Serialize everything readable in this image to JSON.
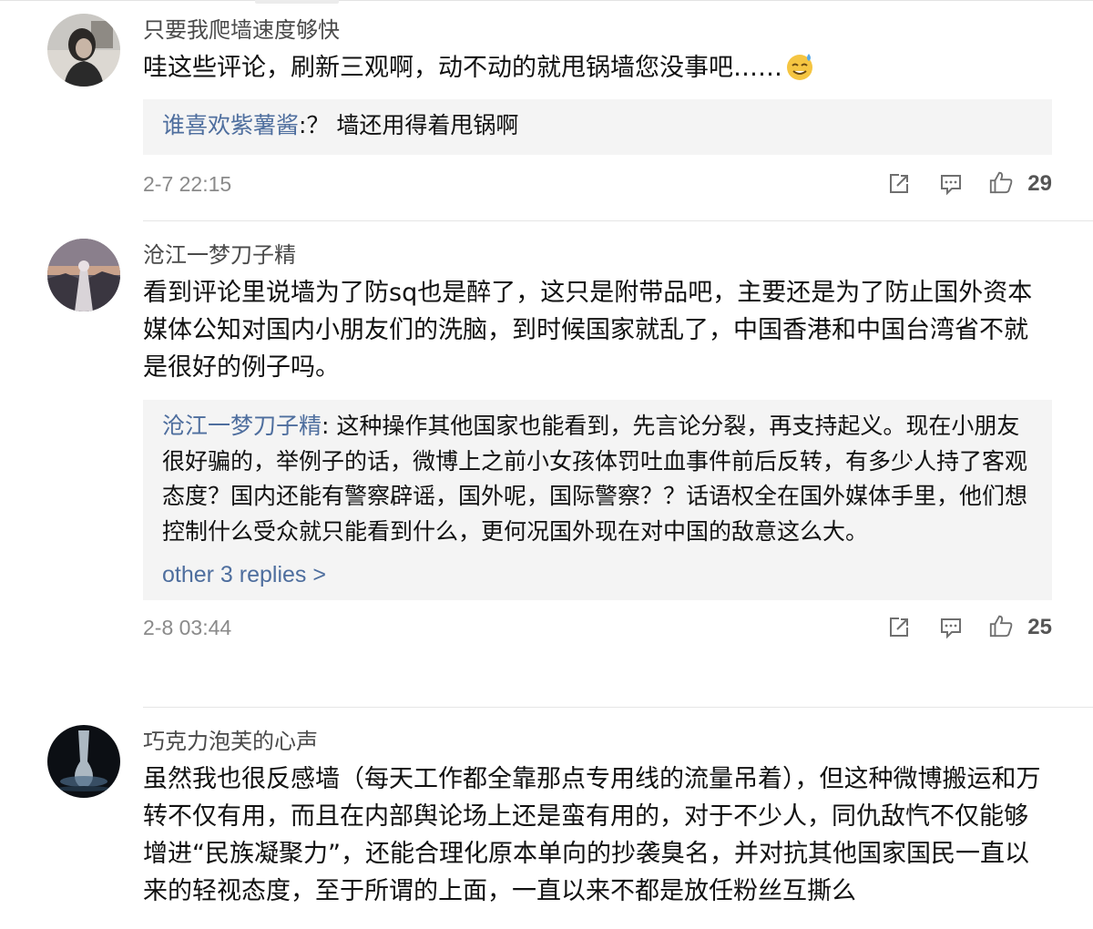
{
  "comments": [
    {
      "username": "只要我爬墙速度够快",
      "text": "哇这些评论，刷新三观啊，动不动的就甩锅墙您没事吧……",
      "emoji_icon": "sweat-smile-emoji-icon",
      "reply": {
        "user": "谁喜欢紫薯酱",
        "text": ":？ 墙还用得着甩锅啊"
      },
      "timestamp": "2-7 22:15",
      "likes": "29"
    },
    {
      "username": "沧江一梦刀子精",
      "text": "看到评论里说墙为了防sq也是醉了，这只是附带品吧，主要还是为了防止国外资本媒体公知对国内小朋友们的洗脑，到时候国家就乱了，中国香港和中国台湾省不就是很好的例子吗。",
      "reply": {
        "user": "沧江一梦刀子精",
        "text": ": 这种操作其他国家也能看到，先言论分裂，再支持起义。现在小朋友很好骗的，举例子的话，微博上之前小女孩体罚吐血事件前后反转，有多少人持了客观态度？国内还能有警察辟谣，国外呢，国际警察？？话语权全在国外媒体手里，他们想控制什么受众就只能看到什么，更何况国外现在对中国的敌意这么大。"
      },
      "more_replies": "other 3 replies >",
      "timestamp": "2-8 03:44",
      "likes": "25"
    },
    {
      "username": "巧克力泡芙的心声",
      "text": "虽然我也很反感墙（每天工作都全靠那点专用线的流量吊着），但这种微博搬运和万转不仅有用，而且在内部舆论场上还是蛮有用的，对于不少人，同仇敌忾不仅能够增进“民族凝聚力”，还能合理化原本单向的抄袭臭名，并对抗其他国家国民一直以来的轻视态度，至于所谓的上面，一直以来不都是放任粉丝互撕么"
    }
  ],
  "icons": {
    "share": "share-icon",
    "reply": "comment-icon",
    "like": "thumbs-up-icon"
  },
  "colors": {
    "link": "#4e6e9e",
    "reply_bg": "#f4f4f4",
    "meta": "#8a8a8a"
  }
}
